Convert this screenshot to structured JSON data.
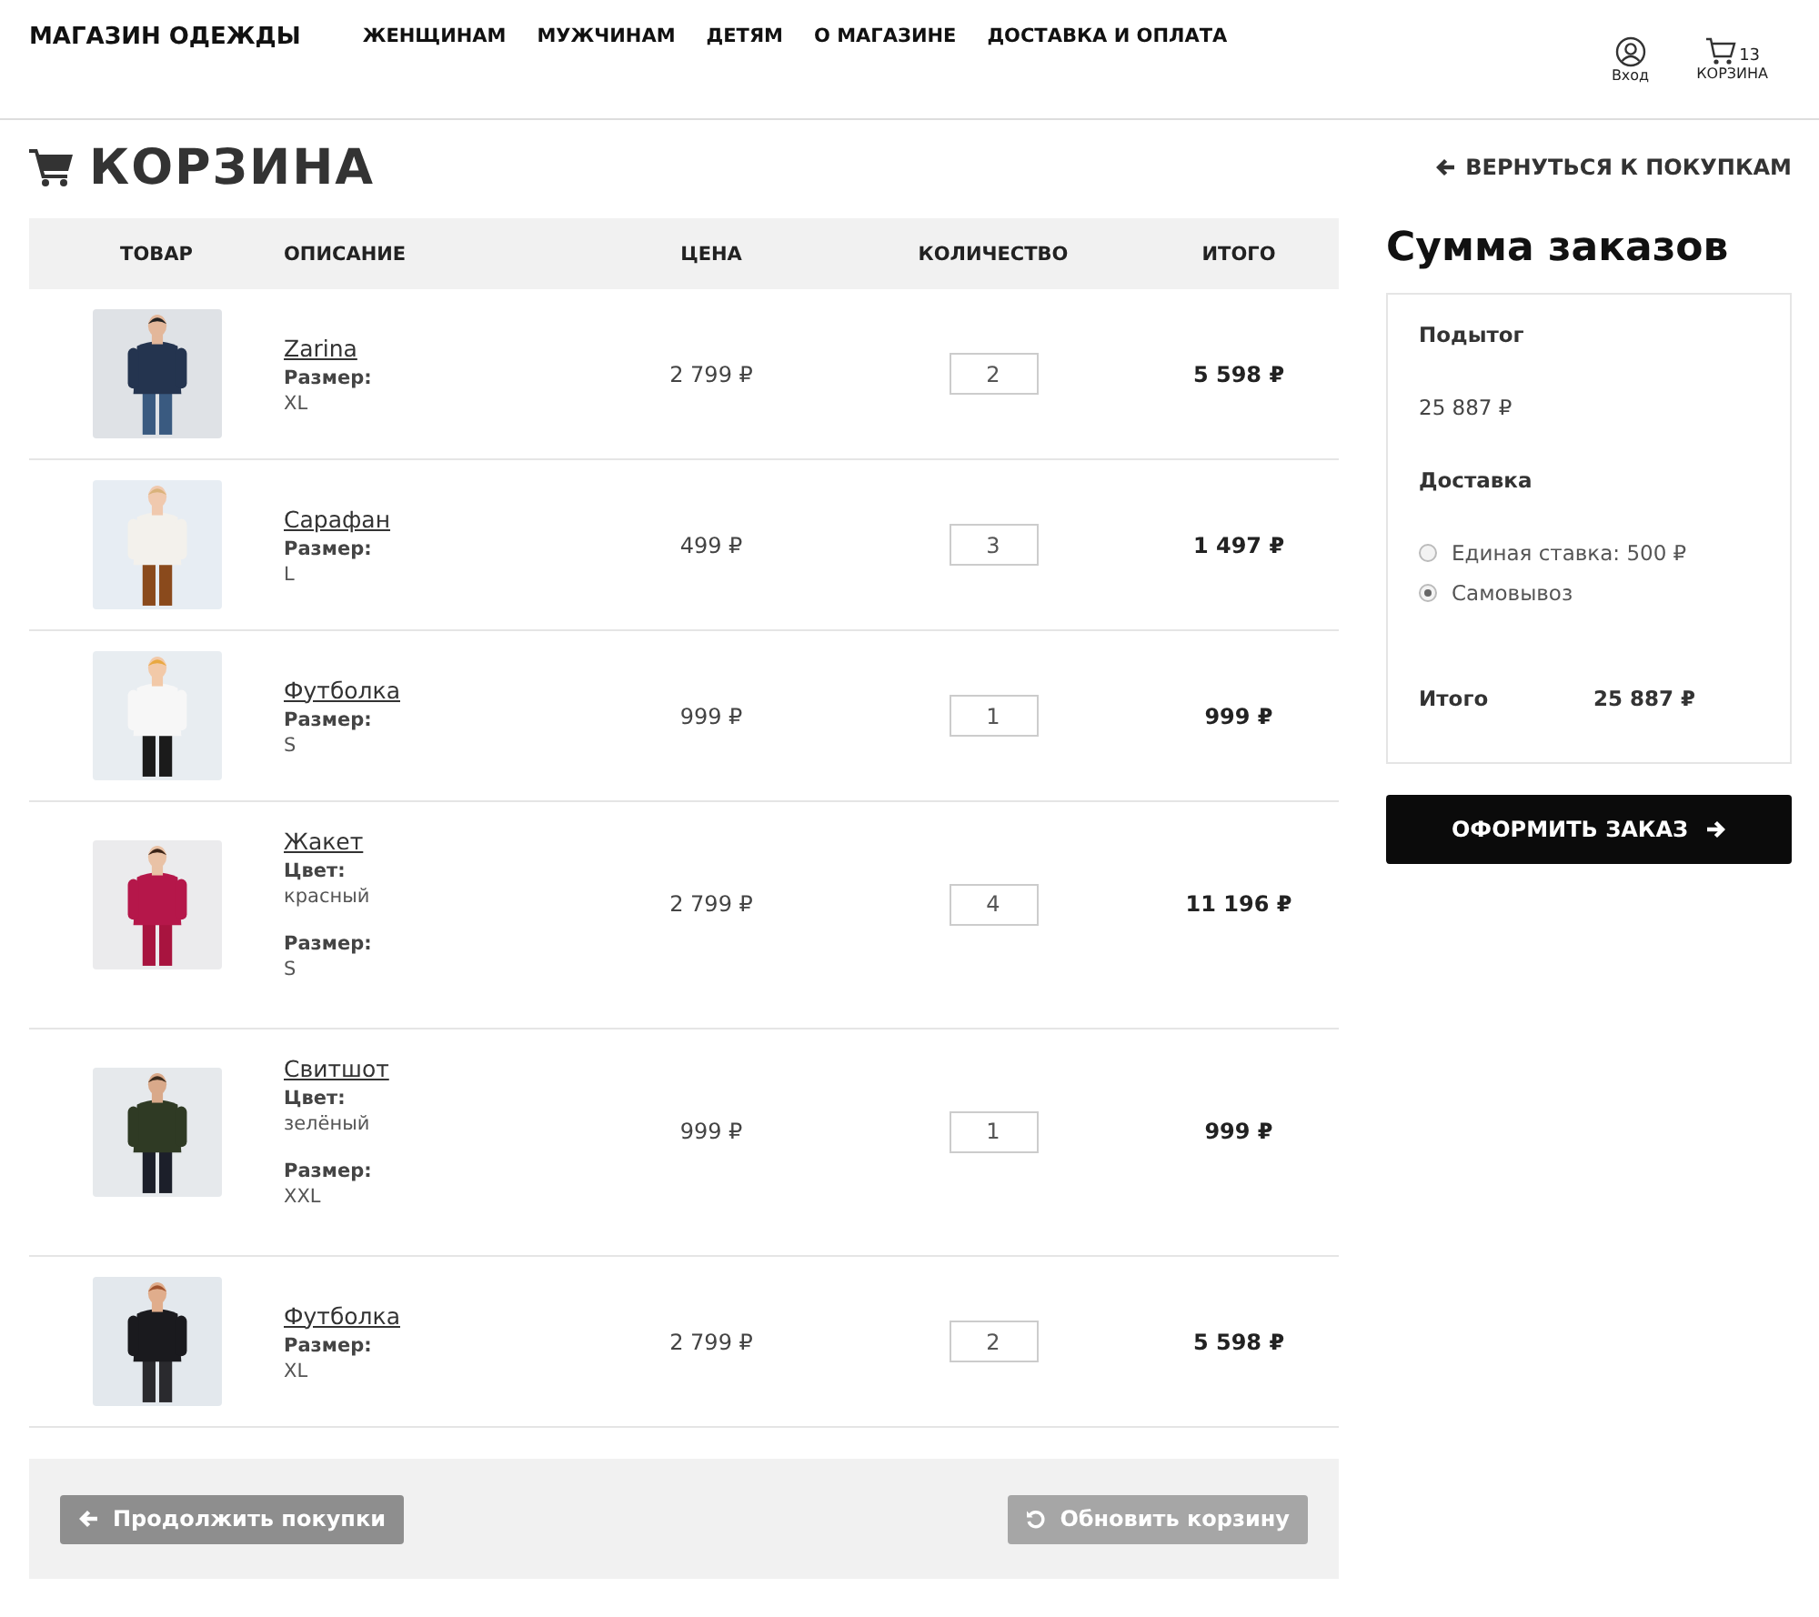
{
  "header": {
    "logo": "МАГАЗИН ОДЕЖДЫ",
    "nav": [
      "ЖЕНЩИНАМ",
      "МУЖЧИНАМ",
      "ДЕТЯМ",
      "О МАГАЗИНЕ",
      "ДОСТАВКА И ОПЛАТА"
    ],
    "account": "Вход",
    "cart": {
      "label": "КОРЗИНА",
      "count": "13"
    }
  },
  "page_title": "КОРЗИНА",
  "back_link": "ВЕРНУТЬСЯ К ПОКУПКАМ",
  "table": {
    "columns": [
      "ТОВАР",
      "ОПИСАНИЕ",
      "ЦЕНА",
      "КОЛИЧЕСТВО",
      "ИТОГО"
    ],
    "rows": [
      {
        "name": "Zarina",
        "attributes": [
          {
            "label": "Размер:",
            "value": "XL"
          }
        ],
        "price": "2 799 ₽",
        "quantity": "2",
        "total": "5 598 ₽"
      },
      {
        "name": "Сарафан",
        "attributes": [
          {
            "label": "Размер:",
            "value": "L"
          }
        ],
        "price": "499 ₽",
        "quantity": "3",
        "total": "1 497 ₽"
      },
      {
        "name": "Футболка",
        "attributes": [
          {
            "label": "Размер:",
            "value": "S"
          }
        ],
        "price": "999 ₽",
        "quantity": "1",
        "total": "999 ₽"
      },
      {
        "name": "Жакет",
        "attributes": [
          {
            "label": "Цвет:",
            "value": "красный"
          },
          {
            "label": "Размер:",
            "value": "S"
          }
        ],
        "price": "2 799 ₽",
        "quantity": "4",
        "total": "11 196 ₽"
      },
      {
        "name": "Свитшот",
        "attributes": [
          {
            "label": "Цвет:",
            "value": "зелёный"
          },
          {
            "label": "Размер:",
            "value": "XXL"
          }
        ],
        "price": "999 ₽",
        "quantity": "1",
        "total": "999 ₽"
      },
      {
        "name": "Футболка",
        "attributes": [
          {
            "label": "Размер:",
            "value": "XL"
          }
        ],
        "price": "2 799 ₽",
        "quantity": "2",
        "total": "5 598 ₽"
      }
    ]
  },
  "actions": {
    "continue": "Продолжить покупки",
    "update": {
      "label": "Обновить корзину",
      "disabled": true
    }
  },
  "summary": {
    "title": "Сумма заказов",
    "subtotal_label": "Подытог",
    "subtotal": "25 887 ₽",
    "shipping_label": "Доставка",
    "shipping_options": [
      {
        "label": "Единая ставка: 500 ₽",
        "selected": false
      },
      {
        "label": "Самовывоз",
        "selected": true
      }
    ],
    "total_label": "Итого",
    "total": "25 887 ₽",
    "checkout": "ОФОРМИТЬ ЗАКАЗ"
  }
}
